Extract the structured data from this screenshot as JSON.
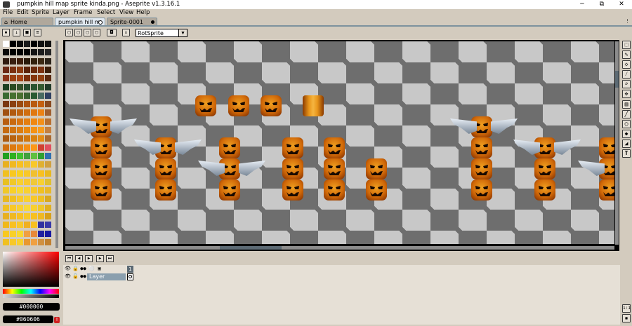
{
  "window": {
    "title": "pumpkin hill map sprite kinda.png - Aseprite v1.3.16.1",
    "minimize": "─",
    "maximize": "⧉",
    "close": "✕"
  },
  "menu": [
    "File",
    "Edit",
    "Sprite",
    "Layer",
    "Frame",
    "Select",
    "View",
    "Help"
  ],
  "tabs": [
    {
      "label": "Home",
      "icon": "home-icon"
    },
    {
      "label": "pumpkin hill m",
      "active": true
    },
    {
      "label": "Sprite-0001"
    }
  ],
  "context": {
    "rotation_algorithm": "RotSprite"
  },
  "colors": {
    "foreground": "#000000",
    "background": "#060606"
  },
  "timeline": {
    "frame": "1",
    "layer": "Layer"
  },
  "tools": [
    "marquee",
    "pencil",
    "eraser",
    "eyedropper",
    "zoom",
    "move",
    "gradient",
    "line",
    "ellipse",
    "fill",
    "blur",
    "text"
  ],
  "scale_label": "1:1"
}
